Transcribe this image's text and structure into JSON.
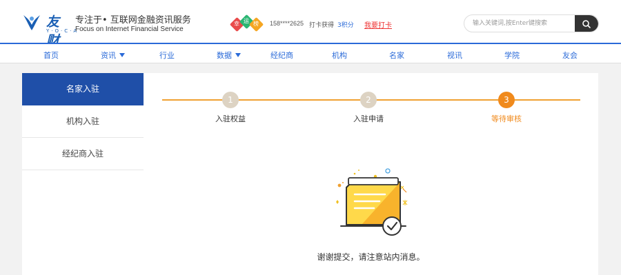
{
  "header": {
    "logo_word": "友财",
    "logo_sub": "Y·O·C·A",
    "slogan_cn": "专注于• 互联网金融资讯服务",
    "slogan_en": "Focus on Internet Financial Service",
    "lucky_chars": [
      "幸",
      "运",
      "榜"
    ],
    "phone": "158****2625",
    "checkin_text": "打卡获得",
    "points": "3积分",
    "checkin_link": "我要打卡",
    "search_placeholder": "输入关键词,按Enter键搜索",
    "colors": {
      "brand": "#1a5fb4",
      "nav_blue": "#2a6ad8",
      "accent": "#f0a030",
      "link_red": "#e33"
    }
  },
  "nav": {
    "items": [
      {
        "label": "首页"
      },
      {
        "label": "资讯"
      },
      {
        "label": "行业"
      },
      {
        "label": "数据"
      },
      {
        "label": "经纪商"
      },
      {
        "label": "机构"
      },
      {
        "label": "名家"
      },
      {
        "label": "视讯"
      },
      {
        "label": "学院"
      },
      {
        "label": "友会"
      }
    ]
  },
  "sidebar": {
    "items": [
      {
        "label": "名家入驻",
        "active": true
      },
      {
        "label": "机构入驻",
        "active": false
      },
      {
        "label": "经纪商入驻",
        "active": false
      }
    ]
  },
  "steps": {
    "current": 3,
    "items": [
      {
        "number": "1",
        "label": "入驻权益"
      },
      {
        "number": "2",
        "label": "入驻申请"
      },
      {
        "number": "3",
        "label": "等待审核"
      }
    ]
  },
  "message": "谢谢提交，请注意站内消息。",
  "icons": [
    "logo-icon",
    "search-icon",
    "document-check-icon",
    "caret-down-icon"
  ]
}
